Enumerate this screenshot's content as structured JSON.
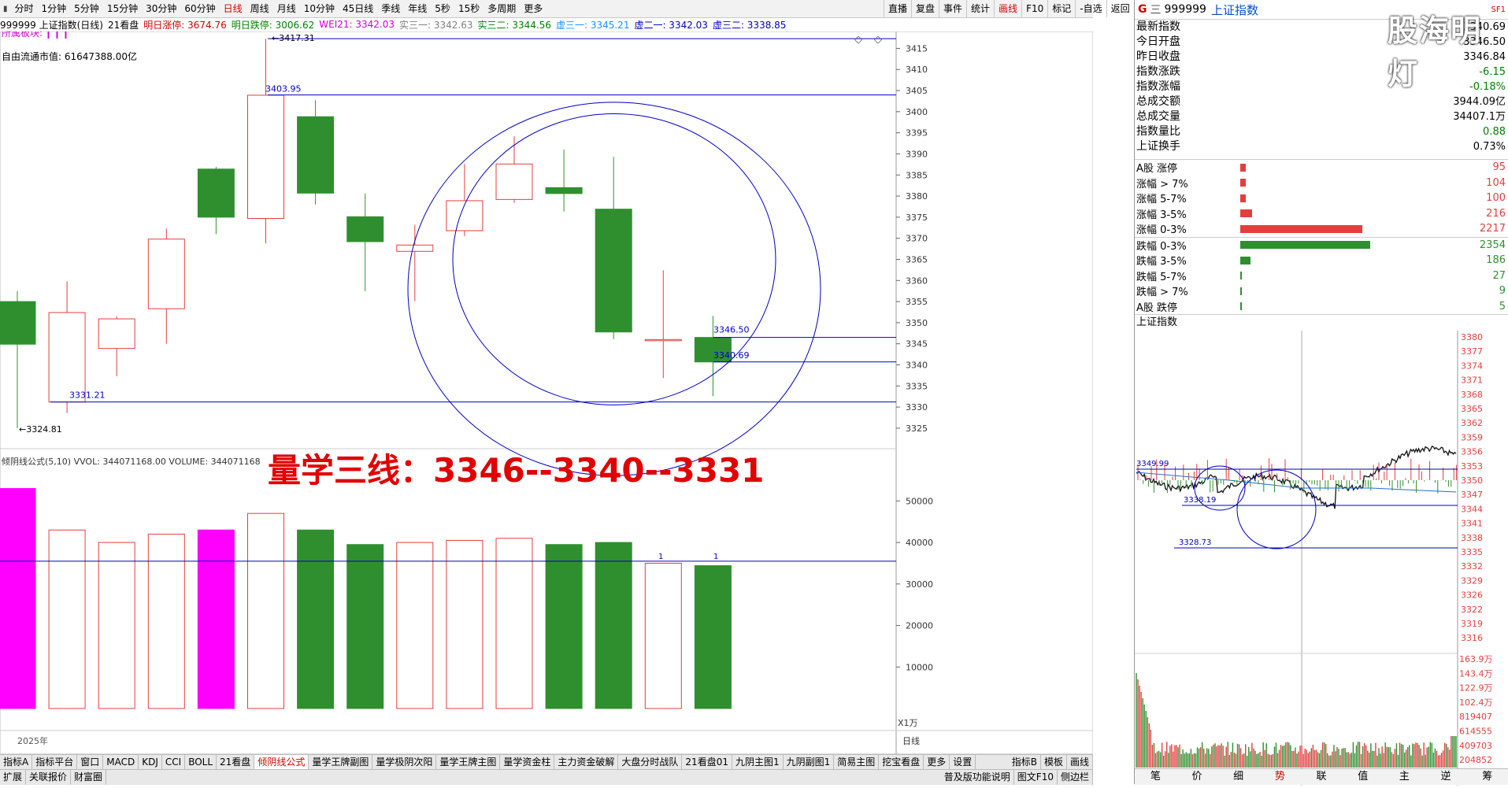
{
  "toolbar": {
    "periods": [
      "分时",
      "1分钟",
      "5分钟",
      "15分钟",
      "30分钟",
      "60分钟",
      "日线",
      "周线",
      "月线",
      "10分钟",
      "45日线",
      "季线",
      "年线",
      "5秒",
      "15秒",
      "多周期",
      "更多"
    ],
    "active_period": "日线",
    "right_buttons": [
      "直播",
      "复盘",
      "事件",
      "统计",
      "画线",
      "F10",
      "标记",
      "-自选",
      "返回"
    ],
    "active_right": "画线"
  },
  "info_row": {
    "code_name": "999999 上证指数(日线)",
    "tpl": "21看盘",
    "limit_up": "明日涨停: 3674.76",
    "limit_down": "明日跌停: 3006.62",
    "wei": "WEI21: 3342.03",
    "s1": "实三一: 3342.63",
    "s2": "实三二: 3344.56",
    "x3_1": "虚三一: 3345.21",
    "x2_1": "虚二一: 3342.03",
    "x3_2": "虚三二: 3338.85"
  },
  "chart_labels": {
    "sector": "所属板块: ┃ ┃ ┃",
    "float_cap": "自由流通市值: 61647388.00亿",
    "high_mark": "3417.31",
    "low_mark": "3324.81",
    "level_3403": "3403.95",
    "level_3331": "3331.21",
    "level_3346": "3346.50",
    "level_3340": "3340.69",
    "headline": "量学三线：3346--3340--3331",
    "volume_header": "倾阴线公式(5,10)  VVOL: 344071168.00  VOLUME: 344071168",
    "vol_unit": "X1万",
    "year": "2025年",
    "period_label": "日线",
    "vol_mark_1": "1",
    "vol_mark_2": "1"
  },
  "chart_data": {
    "type": "candlestick",
    "price_ticks": [
      3415,
      3410,
      3405,
      3400,
      3395,
      3390,
      3385,
      3380,
      3375,
      3370,
      3365,
      3360,
      3355,
      3350,
      3345,
      3340,
      3335,
      3330,
      3325
    ],
    "ylim": [
      3322,
      3419
    ],
    "volume_ticks": [
      50000,
      40000,
      30000,
      20000,
      10000
    ],
    "volume_ylim": [
      0,
      55000
    ],
    "candles": [
      {
        "o": 3355.0,
        "c": 3344.9,
        "h": 3357.5,
        "l": 3325.0,
        "v": 53000,
        "color": "magenta"
      },
      {
        "o": 3331.2,
        "c": 3352.4,
        "h": 3359.8,
        "l": 3328.6,
        "v": 43000
      },
      {
        "o": 3343.9,
        "c": 3350.9,
        "h": 3351.5,
        "l": 3337.3,
        "v": 40000
      },
      {
        "o": 3353.3,
        "c": 3369.8,
        "h": 3372.3,
        "l": 3345.0,
        "v": 42000
      },
      {
        "o": 3386.4,
        "c": 3375.0,
        "h": 3386.9,
        "l": 3371.0,
        "v": 43000,
        "color": "magenta"
      },
      {
        "o": 3374.7,
        "c": 3403.9,
        "h": 3417.3,
        "l": 3368.8,
        "v": 47000
      },
      {
        "o": 3398.8,
        "c": 3380.7,
        "h": 3402.7,
        "l": 3378.0,
        "v": 43000
      },
      {
        "o": 3375.1,
        "c": 3369.2,
        "h": 3380.6,
        "l": 3357.5,
        "v": 39500
      },
      {
        "o": 3366.9,
        "c": 3368.4,
        "h": 3373.2,
        "l": 3355.1,
        "v": 40000
      },
      {
        "o": 3371.8,
        "c": 3378.9,
        "h": 3387.6,
        "l": 3370.5,
        "v": 40500
      },
      {
        "o": 3379.2,
        "c": 3387.6,
        "h": 3394.2,
        "l": 3378.4,
        "v": 41000
      },
      {
        "o": 3382.0,
        "c": 3380.6,
        "h": 3391.0,
        "l": 3376.3,
        "v": 39500
      },
      {
        "o": 3376.9,
        "c": 3347.8,
        "h": 3389.3,
        "l": 3346.1,
        "v": 40000
      },
      {
        "o": 3345.9,
        "c": 3346.0,
        "h": 3362.4,
        "l": 3336.9,
        "v": 35000
      },
      {
        "o": 3346.5,
        "c": 3340.7,
        "h": 3351.6,
        "l": 3332.6,
        "v": 34407
      }
    ],
    "h_levels": [
      3417.3,
      3403.95,
      3346.5,
      3340.69,
      3331.21
    ],
    "volume_line": 35500
  },
  "quote": {
    "badge": "G",
    "flag": "三",
    "code": "999999",
    "name": "上证指数",
    "corner": "SF1",
    "rows": [
      {
        "label": "最新指数",
        "value": "3340.69",
        "color": "#000000"
      },
      {
        "label": "今日开盘",
        "value": "3346.50",
        "color": "#000000"
      },
      {
        "label": "昨日收盘",
        "value": "3346.84",
        "color": "#000000"
      },
      {
        "label": "指数涨跌",
        "value": "-6.15",
        "color": "#008000"
      },
      {
        "label": "指数涨幅",
        "value": "-0.18%",
        "color": "#008000"
      },
      {
        "label": "总成交额",
        "value": "3944.09亿",
        "color": "#000000"
      },
      {
        "label": "总成交量",
        "value": "34407.1万",
        "color": "#000000"
      },
      {
        "label": "指数量比",
        "value": "0.88",
        "color": "#008000"
      },
      {
        "label": "上证换手",
        "value": "0.73%",
        "color": "#000000"
      }
    ],
    "updown": [
      {
        "label": "A股 涨停",
        "value": "95",
        "frac": 0.04,
        "color": "#e33e3e"
      },
      {
        "label": "涨幅 > 7%",
        "value": "104",
        "frac": 0.045,
        "color": "#e33e3e"
      },
      {
        "label": "涨幅 5-7%",
        "value": "100",
        "frac": 0.043,
        "color": "#e33e3e"
      },
      {
        "label": "涨幅 3-5%",
        "value": "216",
        "frac": 0.092,
        "color": "#e33e3e"
      },
      {
        "label": "涨幅 0-3%",
        "value": "2217",
        "frac": 0.94,
        "color": "#e33e3e"
      },
      {
        "label": "跌幅 0-3%",
        "value": "2354",
        "frac": 1.0,
        "color": "#2f8f2f"
      },
      {
        "label": "跌幅 3-5%",
        "value": "186",
        "frac": 0.08,
        "color": "#2f8f2f"
      },
      {
        "label": "跌幅 5-7%",
        "value": "27",
        "frac": 0.012,
        "color": "#2f8f2f"
      },
      {
        "label": "跌幅 > 7%",
        "value": "9",
        "frac": 0.005,
        "color": "#2f8f2f"
      },
      {
        "label": "A股 跌停",
        "value": "5",
        "frac": 0.003,
        "color": "#2f8f2f"
      }
    ]
  },
  "mini_chart": {
    "title": "上证指数",
    "price_ticks": [
      "3380",
      "3377",
      "3374",
      "3371",
      "3368",
      "3365",
      "3362",
      "3359",
      "3356",
      "3353",
      "3350",
      "3347",
      "3344",
      "3341",
      "3338",
      "3335",
      "3332",
      "3329",
      "3326",
      "3322",
      "3319",
      "3316"
    ],
    "vol_ticks": [
      "163.9万",
      "143.4万",
      "122.9万",
      "102.4万",
      "819407",
      "614555",
      "409703",
      "204852"
    ],
    "label_a": "3349.99",
    "label_b": "3338.19",
    "label_c": "3328.73",
    "bottom_tabs": [
      "笔",
      "价",
      "细",
      "势",
      "联",
      "值",
      "主",
      "逆",
      "筹"
    ],
    "active_bottom": "势"
  },
  "bottom_tabs1": [
    "指标A",
    "指标平台",
    "窗口",
    "MACD",
    "KDJ",
    "CCI",
    "BOLL",
    "21看盘",
    "倾阴线公式",
    "量学王牌副图",
    "量学极阴次阳",
    "量学王牌主图",
    "量学资金柱",
    "主力资金破解",
    "大盘分时战队",
    "21看盘01",
    "九阴主图1",
    "九阴副图1",
    "简易主图",
    "挖宝看盘",
    "更多",
    "设置"
  ],
  "active_tab1": "倾阴线公式",
  "bottom_right1": [
    "指标B",
    "模板",
    "画线"
  ],
  "bottom_tabs2": [
    "扩展",
    "关联报价",
    "财富圈"
  ],
  "bottom_right2": [
    "普及版功能说明",
    "图文F10",
    "侧边栏"
  ],
  "watermark": "股海明灯"
}
